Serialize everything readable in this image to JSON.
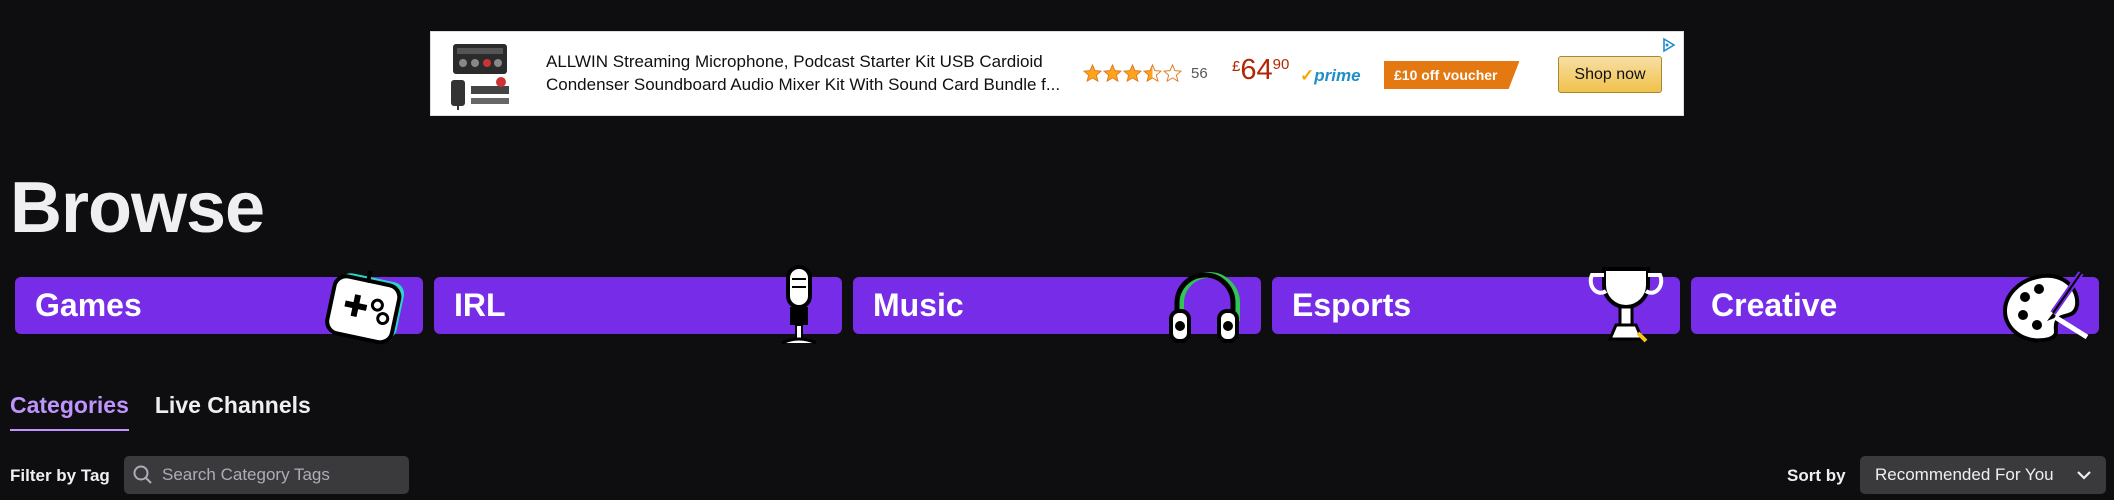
{
  "ad": {
    "title_line1": "ALLWIN Streaming Microphone, Podcast Starter Kit USB Cardioid",
    "title_line2": "Condenser Soundboard Audio Mixer Kit With Sound Card Bundle f...",
    "rating": 3.5,
    "rating_count": "56",
    "price_currency": "£",
    "price_whole": "64",
    "price_fraction": "90",
    "prime_label": "prime",
    "voucher_label": "£10 off voucher",
    "shop_label": "Shop now",
    "colors": {
      "price": "#b12704",
      "voucher": "#e47911",
      "prime": "#1f8ec9"
    }
  },
  "page": {
    "title": "Browse"
  },
  "categories": [
    {
      "label": "Games",
      "icon": "controller-icon"
    },
    {
      "label": "IRL",
      "icon": "microphone-icon"
    },
    {
      "label": "Music",
      "icon": "headphones-icon"
    },
    {
      "label": "Esports",
      "icon": "trophy-icon"
    },
    {
      "label": "Creative",
      "icon": "paint-palette-icon"
    }
  ],
  "tabs": [
    {
      "label": "Categories",
      "active": true
    },
    {
      "label": "Live Channels",
      "active": false
    }
  ],
  "filter": {
    "label": "Filter by Tag",
    "search_placeholder": "Search Category Tags"
  },
  "sort": {
    "label": "Sort by",
    "selected": "Recommended For You"
  },
  "colors": {
    "accent": "#772ce8",
    "active_tab": "#bf94ff",
    "background": "#0e0e10"
  }
}
